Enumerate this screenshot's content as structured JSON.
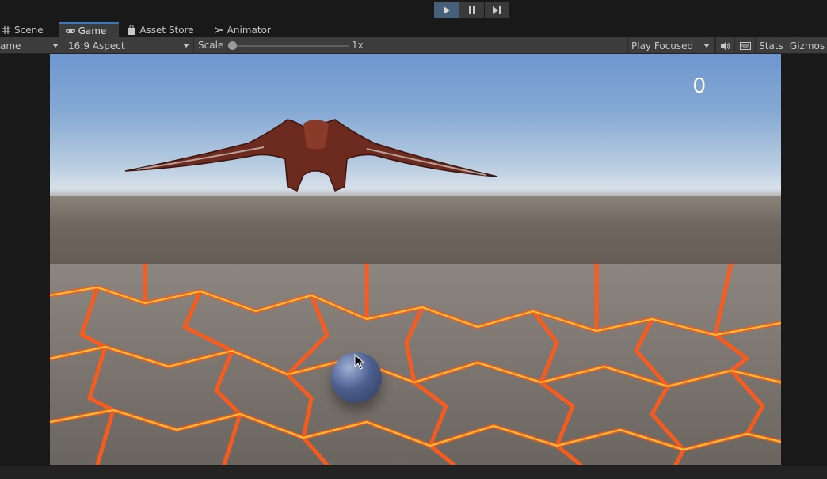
{
  "toolbar": {
    "play_icon": "play-icon",
    "pause_icon": "pause-icon",
    "step_icon": "step-icon"
  },
  "tabs": [
    {
      "label": "Scene",
      "icon": "hash-icon"
    },
    {
      "label": "Game",
      "icon": "gamepad-icon"
    },
    {
      "label": "Asset Store",
      "icon": "bag-icon"
    },
    {
      "label": "Animator",
      "icon": "animator-icon"
    }
  ],
  "game_toolbar": {
    "display": "ame",
    "aspect": "16:9 Aspect",
    "scale_label": "Scale",
    "scale_value": "1x",
    "play_mode": "Play Focused",
    "stats": "Stats",
    "gizmos": "Gizmos"
  },
  "game": {
    "score": "0"
  },
  "colors": {
    "accent": "#3a79bb",
    "play_active": "#46607c",
    "panel": "#3c3c3c",
    "background": "#191919"
  }
}
